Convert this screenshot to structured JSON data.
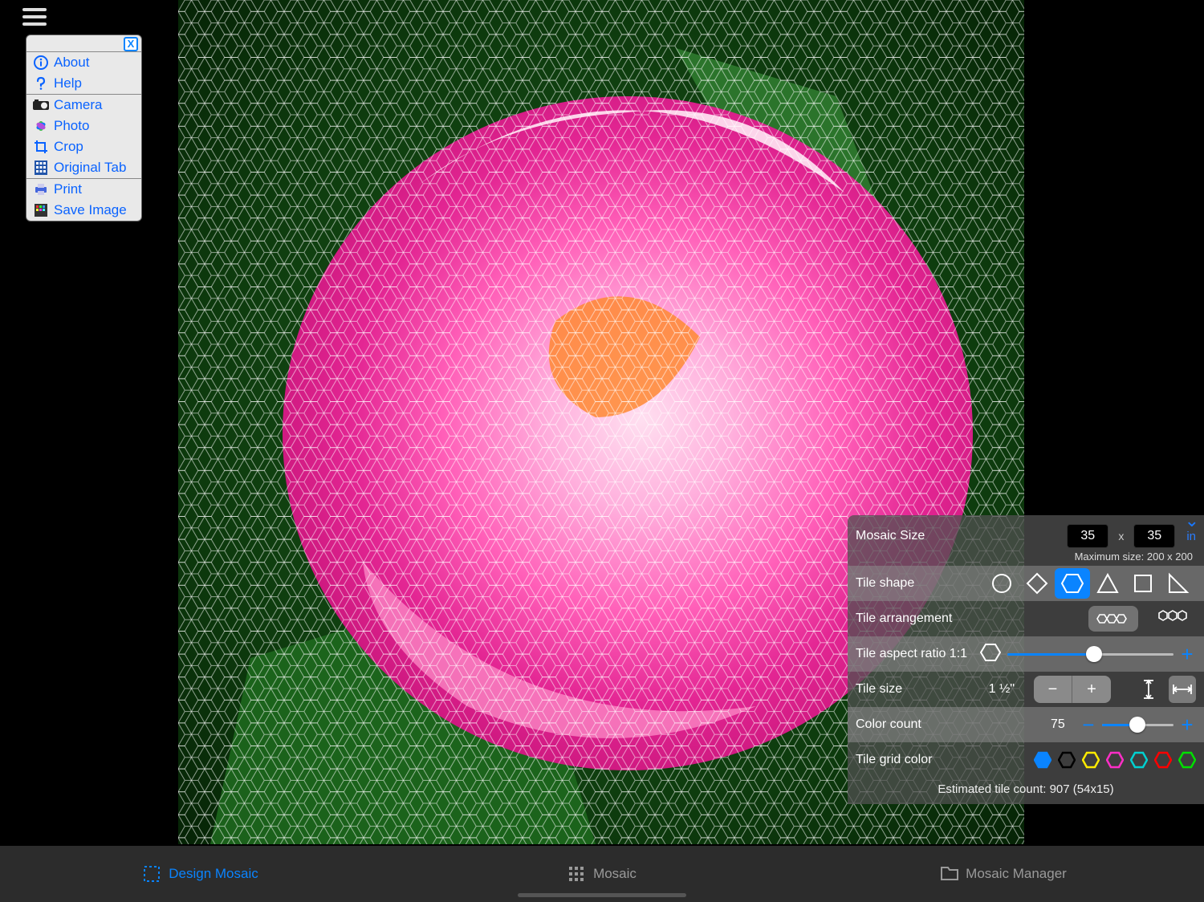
{
  "menu": {
    "group1": [
      {
        "key": "about",
        "label": "About"
      },
      {
        "key": "help",
        "label": "Help"
      }
    ],
    "group2": [
      {
        "key": "camera",
        "label": "Camera"
      },
      {
        "key": "photo",
        "label": "Photo"
      },
      {
        "key": "crop",
        "label": "Crop"
      },
      {
        "key": "orig",
        "label": "Original Tab"
      }
    ],
    "group3": [
      {
        "key": "print",
        "label": "Print"
      },
      {
        "key": "save",
        "label": "Save Image"
      }
    ],
    "close_glyph": "X"
  },
  "panel": {
    "title": "Mosaic Size",
    "width": "35",
    "sep_glyph": "x",
    "height": "35",
    "unit": "in",
    "max_line": "Maximum size: 200 x 200",
    "tile_shape_label": "Tile shape",
    "tile_arrangement_label": "Tile arrangement",
    "tile_aspect_label": "Tile aspect ratio 1:1",
    "tile_size_label": "Tile size",
    "tile_size_value": "1 ½\"",
    "color_count_label": "Color count",
    "color_count_value": "75",
    "grid_color_label": "Tile grid color",
    "grid_colors": [
      "#0a84ff",
      "#000000",
      "#ffeb00",
      "#ff2ec7",
      "#00d0d0",
      "#ff0000",
      "#00e000"
    ],
    "estimate_line": "Estimated tile count: 907 (54x15)",
    "plus_glyph": "+",
    "minus_glyph": "−"
  },
  "tabs": {
    "design": "Design Mosaic",
    "mosaic": "Mosaic",
    "manager": "Mosaic Manager"
  }
}
